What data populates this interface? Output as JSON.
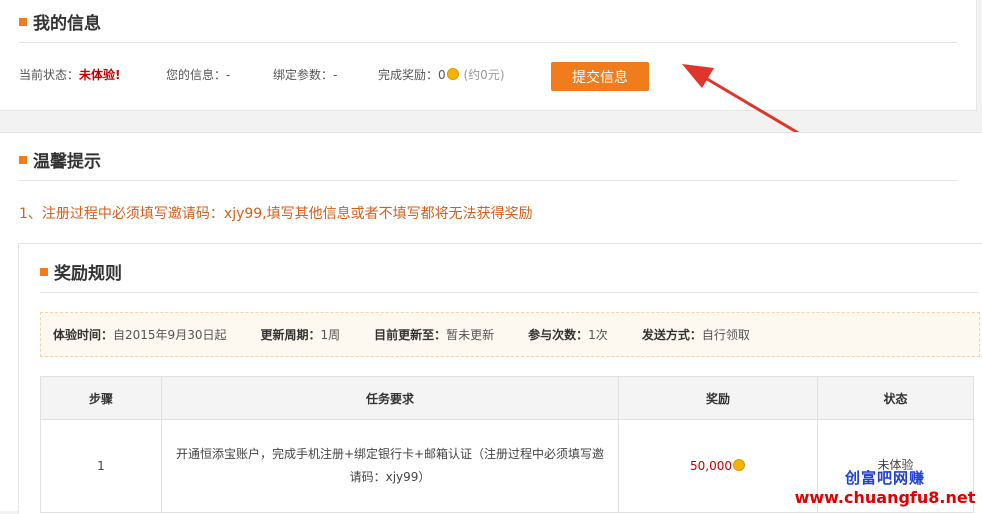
{
  "my_info": {
    "title": "我的信息",
    "status_label": "当前状态：",
    "status_value": "未体验!",
    "your_info_label": "您的信息：",
    "your_info_value": "-",
    "bind_param_label": "绑定参数：",
    "bind_param_value": "-",
    "reward_label": "完成奖励：",
    "reward_value": "0",
    "reward_approx_prefix": "(约",
    "reward_approx_value": "0",
    "reward_approx_suffix": "元)",
    "submit_label": "提交信息"
  },
  "tips": {
    "title": "温馨提示",
    "line1": "1、注册过程中必须填写邀请码：xjy99,填写其他信息或者不填写都将无法获得奖励"
  },
  "rules": {
    "title": "奖励规则",
    "meta": [
      {
        "label": "体验时间：",
        "value": "自2015年9月30日起"
      },
      {
        "label": "更新周期：",
        "value": "1周"
      },
      {
        "label": "目前更新至：",
        "value": "暂未更新"
      },
      {
        "label": "参与次数：",
        "value": "1次"
      },
      {
        "label": "发送方式：",
        "value": "自行领取"
      }
    ],
    "columns": [
      "步骤",
      "任务要求",
      "奖励",
      "状态"
    ],
    "rows": [
      {
        "step": "1",
        "task": "开通恒添宝账户，完成手机注册+绑定银行卡+邮箱认证（注册过程中必须填写邀请码：xjy99）",
        "reward": "50,000",
        "status": "未体验"
      }
    ]
  },
  "watermark": {
    "cn": "创富吧网赚",
    "url": "www.chuangfu8.net"
  },
  "colors": {
    "accent": "#f07c1c",
    "status_red": "#c40000",
    "tip_orange": "#d85e1a",
    "arrow_red": "#e0352b"
  }
}
